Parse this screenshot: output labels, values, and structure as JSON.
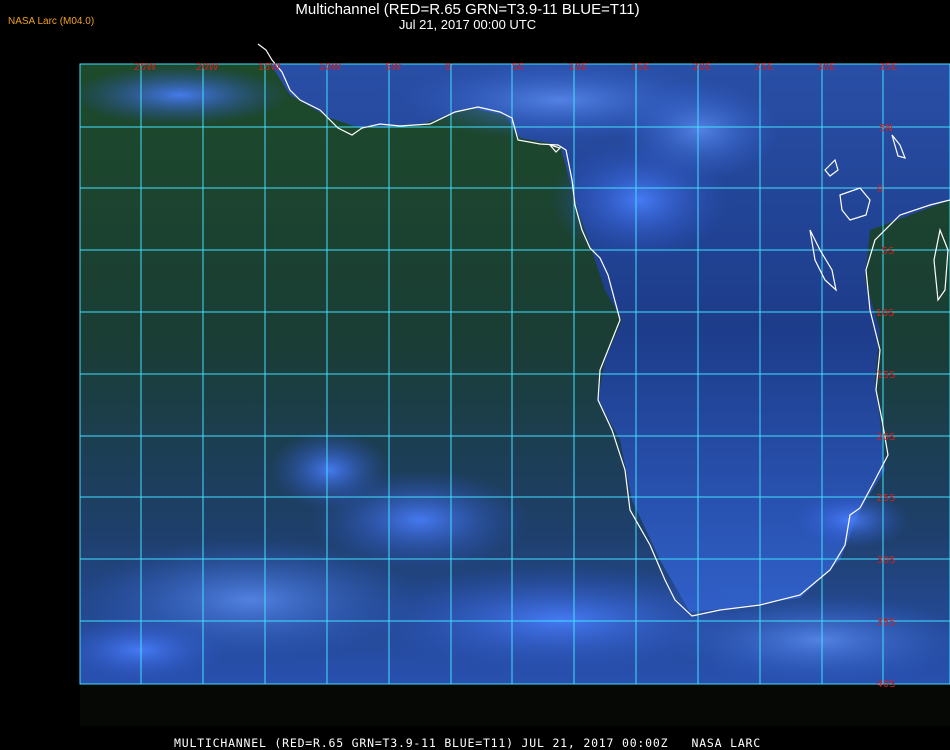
{
  "header": {
    "agency_label": "NASA Larc (M04.0)",
    "title": "Multichannel (RED=R.65 GRN=T3.9-11 BLUE=T11)",
    "subtitle": "Jul 21, 2017 00:00 UTC"
  },
  "map": {
    "longitude_labels": [
      "25W",
      "20W",
      "15W",
      "10W",
      "5W",
      "0",
      "5E",
      "10E",
      "15E",
      "20E",
      "25E",
      "30E",
      "35E"
    ],
    "latitude_labels": [
      "5N",
      "0",
      "5S",
      "10S",
      "15S",
      "20S",
      "25S",
      "30S",
      "35S",
      "40S"
    ],
    "grid_color": "#40e0ff",
    "label_color": "#d02020",
    "coastline_color": "#ffffff",
    "ocean_color": "#1a3a2a",
    "cloud_color": "#3a6ae0"
  },
  "footer": {
    "caption": "MULTICHANNEL (RED=R.65 GRN=T3.9-11 BLUE=T11) JUL 21, 2017 00:00Z   NASA LARC"
  }
}
